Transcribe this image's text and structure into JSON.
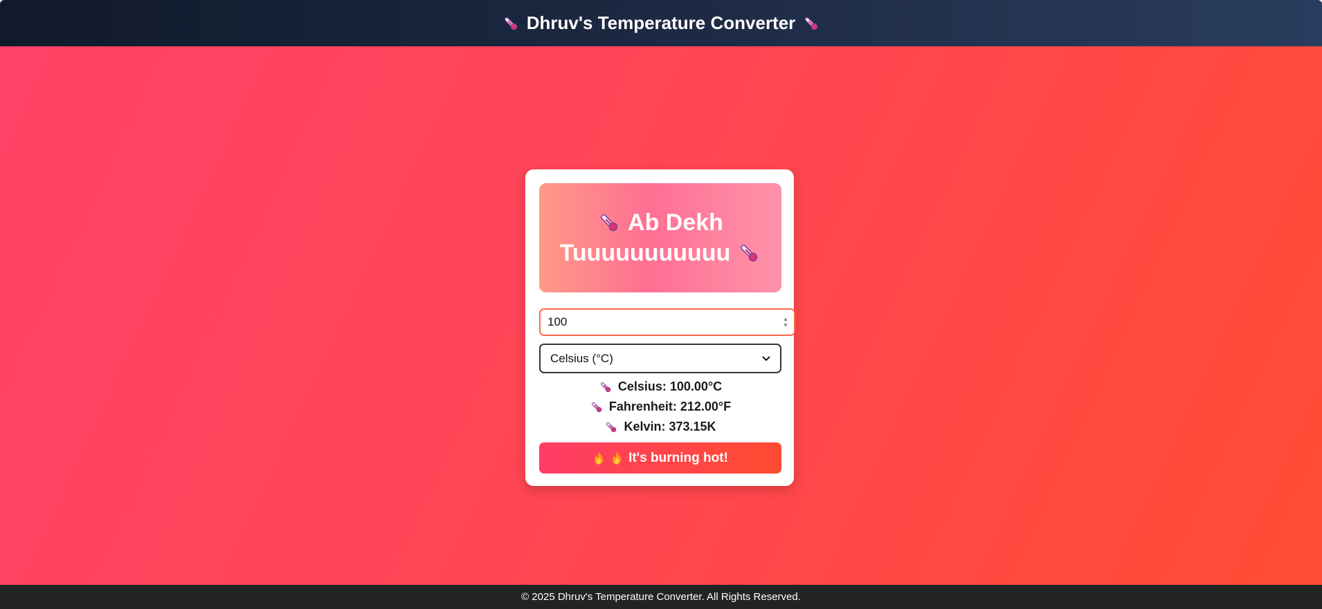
{
  "header": {
    "title": "Dhruv's Temperature Converter",
    "icon": "thermometer-icon"
  },
  "card": {
    "banner": {
      "line1": "Ab Dekh",
      "line2": "Tuuuuuuuuuuu",
      "icon": "thermometer-icon"
    },
    "input": {
      "value": "100"
    },
    "unit_select": {
      "selected": "Celsius (°C)"
    },
    "results": [
      {
        "text": "Celsius: 100.00°C"
      },
      {
        "text": "Fahrenheit: 212.00°F"
      },
      {
        "text": "Kelvin: 373.15K"
      }
    ],
    "status_button": {
      "label": "It's burning hot!",
      "icon": "fire-icon"
    }
  },
  "footer": {
    "text": "© 2025 Dhruv's Temperature Converter. All Rights Reserved."
  },
  "colors": {
    "header_bg": "#1e2b45",
    "main_gradient_start": "#ff4266",
    "main_gradient_end": "#ff4c33",
    "banner_gradient": "#ff6f93",
    "button_gradient_start": "#ff3d66",
    "button_gradient_end": "#ff4b30",
    "footer_bg": "#232323"
  }
}
